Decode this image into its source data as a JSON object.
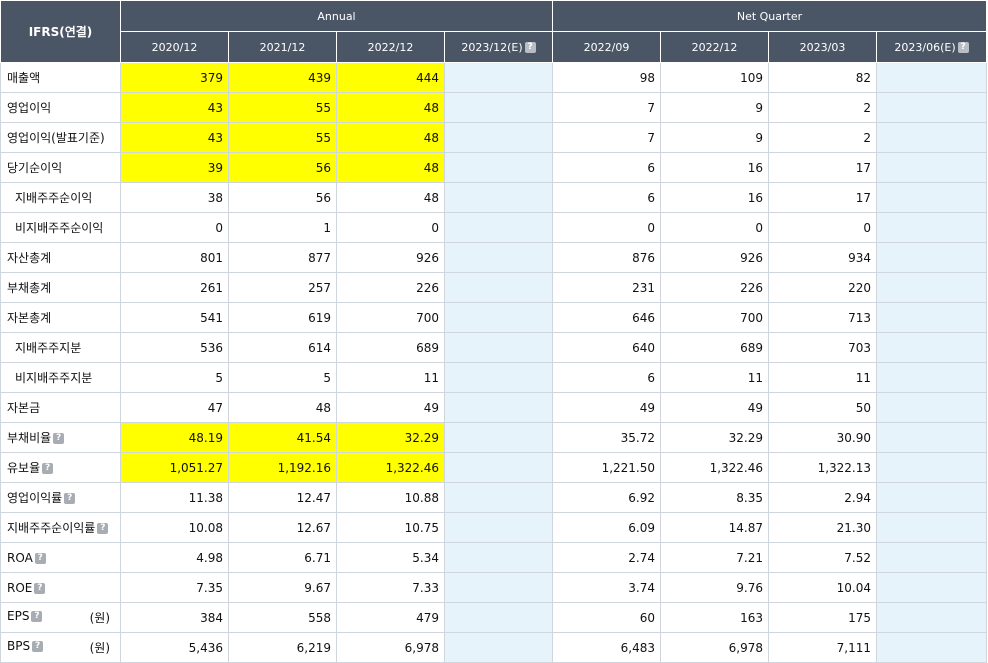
{
  "header": {
    "corner": "IFRS(연결)",
    "annual": "Annual",
    "quarter": "Net Quarter",
    "periods": [
      "2020/12",
      "2021/12",
      "2022/12",
      "2023/12(E)",
      "2022/09",
      "2022/12",
      "2023/03",
      "2023/06(E)"
    ]
  },
  "help_glyph": "?",
  "rows": [
    {
      "label": "매출액",
      "sub": false,
      "help": false,
      "unit": "",
      "values": [
        "379",
        "439",
        "444",
        "",
        "98",
        "109",
        "82",
        ""
      ],
      "highlight": true
    },
    {
      "label": "영업이익",
      "sub": false,
      "help": false,
      "unit": "",
      "values": [
        "43",
        "55",
        "48",
        "",
        "7",
        "9",
        "2",
        ""
      ],
      "highlight": true
    },
    {
      "label": "영업이익(발표기준)",
      "sub": false,
      "help": false,
      "unit": "",
      "values": [
        "43",
        "55",
        "48",
        "",
        "7",
        "9",
        "2",
        ""
      ],
      "highlight": true
    },
    {
      "label": "당기순이익",
      "sub": false,
      "help": false,
      "unit": "",
      "values": [
        "39",
        "56",
        "48",
        "",
        "6",
        "16",
        "17",
        ""
      ],
      "highlight": true
    },
    {
      "label": "지배주주순이익",
      "sub": true,
      "help": false,
      "unit": "",
      "values": [
        "38",
        "56",
        "48",
        "",
        "6",
        "16",
        "17",
        ""
      ],
      "highlight": false
    },
    {
      "label": "비지배주주순이익",
      "sub": true,
      "help": false,
      "unit": "",
      "values": [
        "0",
        "1",
        "0",
        "",
        "0",
        "0",
        "0",
        ""
      ],
      "highlight": false
    },
    {
      "label": "자산총계",
      "sub": false,
      "help": false,
      "unit": "",
      "values": [
        "801",
        "877",
        "926",
        "",
        "876",
        "926",
        "934",
        ""
      ],
      "highlight": false
    },
    {
      "label": "부채총계",
      "sub": false,
      "help": false,
      "unit": "",
      "values": [
        "261",
        "257",
        "226",
        "",
        "231",
        "226",
        "220",
        ""
      ],
      "highlight": false
    },
    {
      "label": "자본총계",
      "sub": false,
      "help": false,
      "unit": "",
      "values": [
        "541",
        "619",
        "700",
        "",
        "646",
        "700",
        "713",
        ""
      ],
      "highlight": false
    },
    {
      "label": "지배주주지분",
      "sub": true,
      "help": false,
      "unit": "",
      "values": [
        "536",
        "614",
        "689",
        "",
        "640",
        "689",
        "703",
        ""
      ],
      "highlight": false
    },
    {
      "label": "비지배주주지분",
      "sub": true,
      "help": false,
      "unit": "",
      "values": [
        "5",
        "5",
        "11",
        "",
        "6",
        "11",
        "11",
        ""
      ],
      "highlight": false
    },
    {
      "label": "자본금",
      "sub": false,
      "help": false,
      "unit": "",
      "values": [
        "47",
        "48",
        "49",
        "",
        "49",
        "49",
        "50",
        ""
      ],
      "highlight": false
    },
    {
      "label": "부채비율",
      "sub": false,
      "help": true,
      "unit": "",
      "values": [
        "48.19",
        "41.54",
        "32.29",
        "",
        "35.72",
        "32.29",
        "30.90",
        ""
      ],
      "highlight": true
    },
    {
      "label": "유보율",
      "sub": false,
      "help": true,
      "unit": "",
      "values": [
        "1,051.27",
        "1,192.16",
        "1,322.46",
        "",
        "1,221.50",
        "1,322.46",
        "1,322.13",
        ""
      ],
      "highlight": true
    },
    {
      "label": "영업이익률",
      "sub": false,
      "help": true,
      "unit": "",
      "values": [
        "11.38",
        "12.47",
        "10.88",
        "",
        "6.92",
        "8.35",
        "2.94",
        ""
      ],
      "highlight": false
    },
    {
      "label": "지배주주순이익률",
      "sub": false,
      "help": true,
      "unit": "",
      "values": [
        "10.08",
        "12.67",
        "10.75",
        "",
        "6.09",
        "14.87",
        "21.30",
        ""
      ],
      "highlight": false
    },
    {
      "label": "ROA",
      "sub": false,
      "help": true,
      "unit": "",
      "values": [
        "4.98",
        "6.71",
        "5.34",
        "",
        "2.74",
        "7.21",
        "7.52",
        ""
      ],
      "highlight": false
    },
    {
      "label": "ROE",
      "sub": false,
      "help": true,
      "unit": "",
      "values": [
        "7.35",
        "9.67",
        "7.33",
        "",
        "3.74",
        "9.76",
        "10.04",
        ""
      ],
      "highlight": false
    },
    {
      "label": "EPS",
      "sub": false,
      "help": true,
      "unit": "(원)",
      "values": [
        "384",
        "558",
        "479",
        "",
        "60",
        "163",
        "175",
        ""
      ],
      "highlight": false
    },
    {
      "label": "BPS",
      "sub": false,
      "help": true,
      "unit": "(원)",
      "values": [
        "5,436",
        "6,219",
        "6,978",
        "",
        "6,483",
        "6,978",
        "7,111",
        ""
      ],
      "highlight": false
    }
  ],
  "colors": {
    "header_bg": "#4a5665",
    "estimate_bg": "#e6f3fa",
    "highlight": "#ffff00",
    "border": "#cfd6de"
  }
}
